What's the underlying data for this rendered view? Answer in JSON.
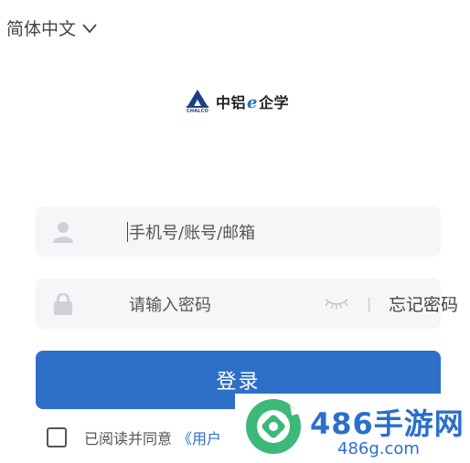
{
  "language": {
    "label": "简体中文",
    "icon": "chevron-down-icon"
  },
  "logo": {
    "brand_prefix": "中铝",
    "brand_e": "e",
    "brand_suffix": "企学",
    "mark_caption": "CHALCO"
  },
  "form": {
    "account": {
      "placeholder": "手机号/账号/邮箱",
      "icon": "user-icon"
    },
    "password": {
      "placeholder": "请输入密码",
      "icon": "lock-icon",
      "visibility_icon": "eye-closed-icon",
      "divider": "|",
      "forgot_label": "忘记密码"
    },
    "login_label": "登录",
    "agreement": {
      "text": "已阅读并同意",
      "link": "《用户",
      "checked": false
    }
  },
  "watermark": {
    "title": "486手游网",
    "url": "486g.com"
  },
  "colors": {
    "primary": "#2e6fc8",
    "field_bg": "#f5f6f8",
    "watermark": "#2a6fcb",
    "watermark_green": "#3cb878"
  }
}
